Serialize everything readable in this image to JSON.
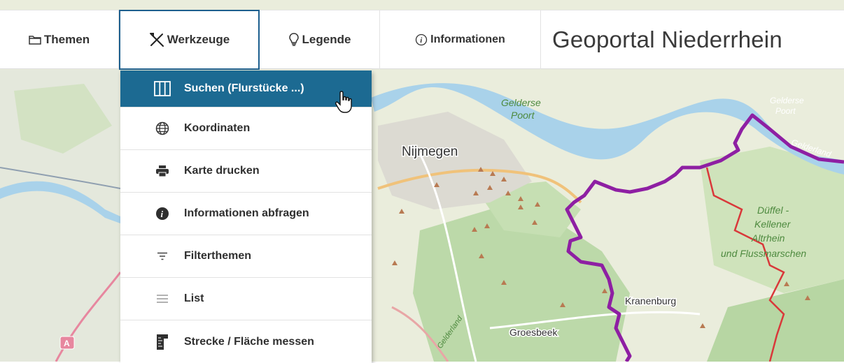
{
  "tabs": [
    {
      "label": "Themen",
      "icon": "folder-icon"
    },
    {
      "label": "Werkzeuge",
      "icon": "tools-icon"
    },
    {
      "label": "Legende",
      "icon": "lightbulb-icon"
    },
    {
      "label": "Informationen",
      "icon": "info-circle-icon"
    }
  ],
  "portal_title": "Geoportal Niederrhein",
  "menu": {
    "items": [
      {
        "label": "Suchen (Flurstücke ...)",
        "icon": "columns-icon",
        "active": true
      },
      {
        "label": "Koordinaten",
        "icon": "globe-icon"
      },
      {
        "label": "Karte drucken",
        "icon": "printer-icon"
      },
      {
        "label": "Informationen abfragen",
        "icon": "info-filled-icon"
      },
      {
        "label": "Filterthemen",
        "icon": "filter-icon"
      },
      {
        "label": "List",
        "icon": "list-icon"
      },
      {
        "label": "Strecke / Fläche messen",
        "icon": "ruler-icon"
      }
    ]
  },
  "map": {
    "places": [
      "Nijmegen",
      "Kranenburg",
      "Groesbeek"
    ],
    "areas": [
      "Gelderse Poort",
      "Gelderse Poort",
      "Gelderland",
      "Düffel - Kellener Altrhein und Flussmarschen",
      "Gelderland"
    ],
    "road_badge": "A",
    "colors": {
      "border": "#8b1fa0",
      "red_line": "#d9383a",
      "river": "#a8d0ea",
      "forest": "#b6d5a4",
      "land": "#e8ecd8"
    }
  }
}
